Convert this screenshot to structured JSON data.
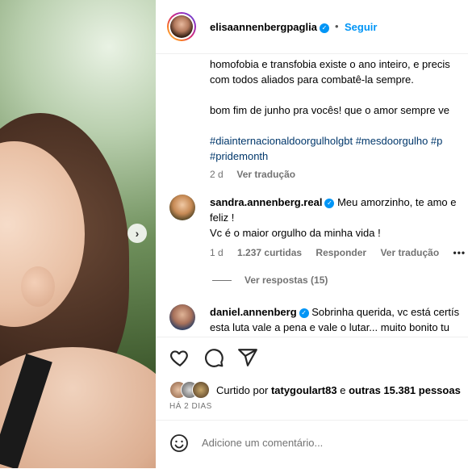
{
  "post": {
    "username": "elisaannenbergpaglia",
    "verified": true,
    "separator": "•",
    "follow_label": "Seguir",
    "caption_lines": [
      "homofobia e transfobia existe o ano inteiro, e precis",
      "com todos aliados para combatê-la sempre.",
      "",
      "bom fim de junho pra vocês! que o amor sempre ve"
    ],
    "hashtag_lines": [
      "#diainternacionaldoorgulholgbt #mesdoorgulho #p",
      "#pridemonth"
    ],
    "caption_age": "2 d",
    "caption_translate": "Ver tradução"
  },
  "comments": [
    {
      "username": "sandra.annenberg.real",
      "verified": true,
      "text_lines": [
        "Meu amorzinho, te amo e",
        "feliz !",
        "Vc é o maior orgulho da minha vida !"
      ],
      "age": "1 d",
      "likes": "1.237 curtidas",
      "reply": "Responder",
      "translate": "Ver tradução",
      "more": "•••",
      "replies_label": "Ver respostas (15)"
    },
    {
      "username": "daniel.annenberg",
      "verified": true,
      "text_lines": [
        "Sobrinha querida, vc está certís",
        "esta luta vale a pena e vale o lutar... muito bonito tu"
      ]
    }
  ],
  "actions": {
    "liked_by_prefix": "Curtido por",
    "liked_by_user": "tatygoulart83",
    "liked_by_conj": "e",
    "liked_by_others": "outras 15.381 pessoas",
    "time_ago": "HÁ 2 DIAS",
    "comment_placeholder": "Adicione um comentário..."
  },
  "colors": {
    "link_blue": "#0095f6",
    "hashtag": "#00376b",
    "muted": "#737373"
  },
  "icons": [
    "chevron-right-icon",
    "verified-icon",
    "heart-icon",
    "comment-icon",
    "share-icon",
    "emoji-icon"
  ]
}
